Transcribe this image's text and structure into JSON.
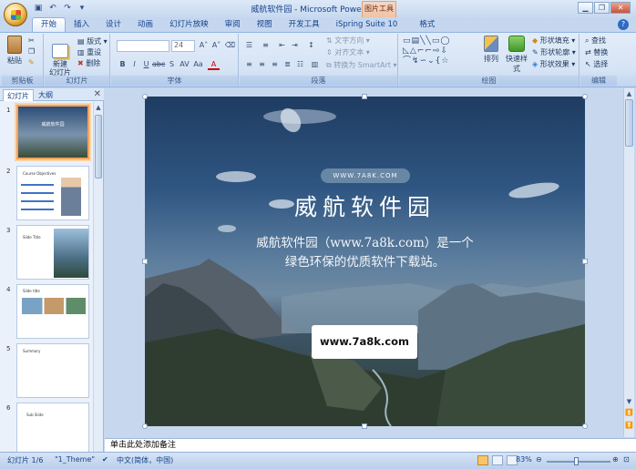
{
  "window": {
    "title": "威航软件园 - Microsoft PowerPoint",
    "context_tab_group": "图片工具",
    "controls": [
      "▁",
      "❐",
      "✕"
    ]
  },
  "ribbon_tabs": [
    "开始",
    "插入",
    "设计",
    "动画",
    "幻灯片放映",
    "审阅",
    "视图",
    "开发工具",
    "iSpring Suite 10",
    "格式"
  ],
  "groups": {
    "clipboard": {
      "label": "剪贴板",
      "paste": "粘贴"
    },
    "slides": {
      "label": "幻灯片",
      "new_slide": "新建\n幻灯片",
      "layout": "版式",
      "reset": "重设",
      "delete": "删除"
    },
    "font": {
      "label": "字体",
      "font_name": "",
      "font_size": "24"
    },
    "paragraph": {
      "label": "段落",
      "text_direction": "文字方向",
      "align_text": "对齐文本",
      "smartart": "转换为 SmartArt"
    },
    "drawing": {
      "label": "绘图",
      "arrange": "排列",
      "quick_styles": "快速样式",
      "shape_fill": "形状填充",
      "shape_outline": "形状轮廓",
      "shape_effects": "形状效果"
    },
    "editing": {
      "label": "编辑",
      "find": "查找",
      "replace": "替换",
      "select": "选择"
    }
  },
  "panel": {
    "tabs": [
      "幻灯片",
      "大纲"
    ],
    "slides": [
      {
        "num": "1",
        "title": "威航软件园"
      },
      {
        "num": "2",
        "title": "Course Objectives"
      },
      {
        "num": "3",
        "title": "Slide Title"
      },
      {
        "num": "4",
        "title": "Slide title"
      },
      {
        "num": "5",
        "title": "Summary"
      },
      {
        "num": "6",
        "title": "Sub Slide"
      }
    ]
  },
  "slide": {
    "pill": "WWW.7A8K.COM",
    "heading": "威航软件园",
    "subtitle_line1": "威航软件园（www.7a8k.com）是一个",
    "subtitle_line2": "绿色环保的优质软件下载站。",
    "url_box": "www.7a8k.com"
  },
  "notes_placeholder": "单击此处添加备注",
  "status": {
    "slide_count": "幻灯片 1/6",
    "theme": "\"1_Theme\"",
    "language": "中文(简体，中国)",
    "zoom": "83%"
  }
}
